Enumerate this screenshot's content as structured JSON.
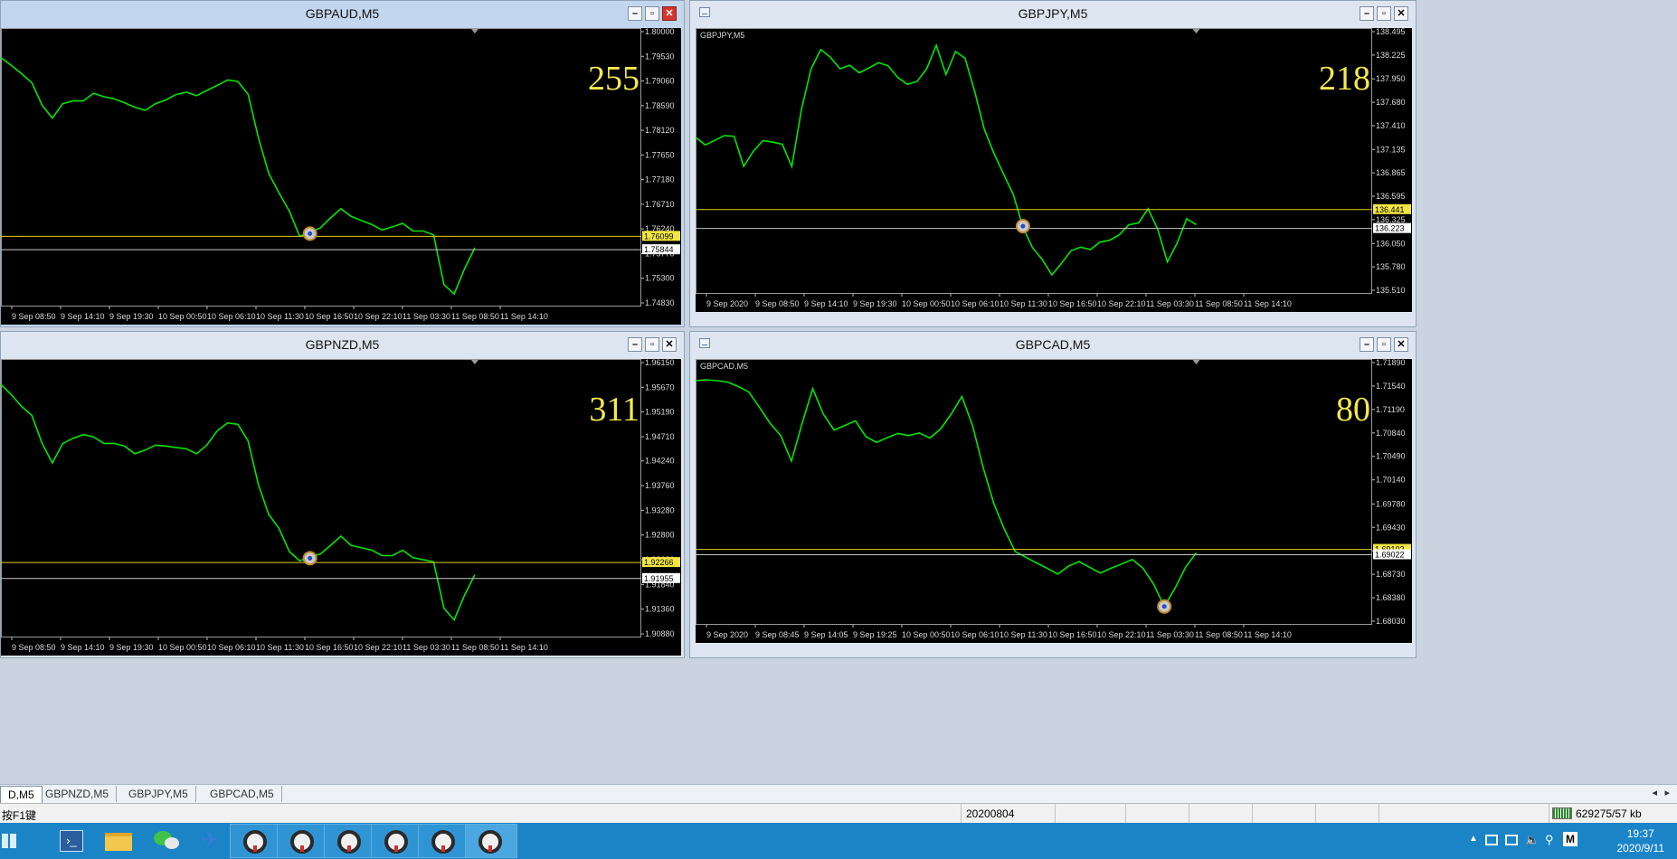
{
  "charts": [
    {
      "title": "GBPAUD,M5",
      "symbol_label": "",
      "countdown": "255",
      "price_axis": [
        "1.80000",
        "1.79530",
        "1.79060",
        "1.78590",
        "1.78120",
        "1.77650",
        "1.77180",
        "1.76710",
        "1.76240",
        "1.75770",
        "1.75300",
        "1.74830"
      ],
      "bid_price": "1.76099",
      "ask_price": "1.75844",
      "time_axis": [
        "9 Sep 08:50",
        "9 Sep 14:10",
        "9 Sep 19:30",
        "10 Sep 00:50",
        "10 Sep 06:10",
        "10 Sep 11:30",
        "10 Sep 16:50",
        "10 Sep 22:10",
        "11 Sep 03:30",
        "11 Sep 08:50",
        "11 Sep 14:10"
      ],
      "series": [
        1.7948,
        1.7938,
        1.792,
        1.79,
        1.7862,
        1.7835,
        1.786,
        1.787,
        1.7868,
        1.788,
        1.7878,
        1.7872,
        1.7862,
        1.7858,
        1.785,
        1.786,
        1.7872,
        1.788,
        1.7882,
        1.788,
        1.7888,
        1.7895,
        1.791,
        1.7905,
        1.7878,
        1.78,
        1.773,
        1.769,
        1.766,
        1.761,
        1.7615,
        1.7628,
        1.7645,
        1.766,
        1.765,
        1.764,
        1.763,
        1.7624,
        1.7628,
        1.7632,
        1.7622,
        1.762,
        1.761,
        1.752,
        1.75,
        1.7545,
        1.759
      ]
    },
    {
      "title": "GBPJPY,M5",
      "symbol_label": "GBPJPY,M5",
      "countdown": "218",
      "price_axis": [
        "138.495",
        "138.225",
        "137.950",
        "137.680",
        "137.410",
        "137.135",
        "136.865",
        "136.595",
        "136.325",
        "136.050",
        "135.780",
        "135.510"
      ],
      "bid_price": "136.441",
      "ask_price": "136.223",
      "time_axis": [
        "9 Sep 2020",
        "9 Sep 08:50",
        "9 Sep 14:10",
        "9 Sep 19:30",
        "10 Sep 00:50",
        "10 Sep 06:10",
        "10 Sep 11:30",
        "10 Sep 16:50",
        "10 Sep 22:10",
        "11 Sep 03:30",
        "11 Sep 08:50",
        "11 Sep 14:10"
      ],
      "series": [
        137.26,
        137.2,
        137.24,
        137.28,
        137.3,
        136.94,
        137.1,
        137.25,
        137.22,
        137.18,
        136.95,
        137.6,
        138.05,
        138.3,
        138.2,
        138.05,
        138.12,
        138.02,
        138.06,
        138.15,
        138.1,
        137.95,
        137.9,
        137.92,
        138.05,
        138.35,
        138.0,
        138.25,
        138.2,
        137.8,
        137.35,
        137.1,
        136.85,
        136.6,
        136.25,
        136.0,
        135.85,
        135.7,
        135.82,
        135.95,
        136.02,
        135.98,
        136.05,
        136.1,
        136.15,
        136.25,
        136.3,
        136.45,
        136.2,
        135.85,
        136.05,
        136.32,
        136.28
      ]
    },
    {
      "title": "GBPNZD,M5",
      "symbol_label": "",
      "countdown": "311",
      "price_axis": [
        "1.96150",
        "1.95670",
        "1.95190",
        "1.94710",
        "1.94240",
        "1.93760",
        "1.93280",
        "1.92800",
        "1.92320",
        "1.91840",
        "1.91360",
        "1.90880"
      ],
      "bid_price": "1.92266",
      "ask_price": "1.91955",
      "time_axis": [
        "9 Sep 08:50",
        "9 Sep 14:10",
        "9 Sep 19:30",
        "10 Sep 00:50",
        "10 Sep 06:10",
        "10 Sep 11:30",
        "10 Sep 16:50",
        "10 Sep 22:10",
        "11 Sep 03:30",
        "11 Sep 08:50",
        "11 Sep 14:10"
      ],
      "series": [
        1.957,
        1.9555,
        1.953,
        1.951,
        1.946,
        1.942,
        1.9455,
        1.947,
        1.9475,
        1.9468,
        1.946,
        1.9458,
        1.945,
        1.944,
        1.9445,
        1.9452,
        1.9455,
        1.945,
        1.9445,
        1.944,
        1.9455,
        1.948,
        1.95,
        1.9495,
        1.946,
        1.938,
        1.932,
        1.929,
        1.925,
        1.923,
        1.9235,
        1.9245,
        1.926,
        1.9275,
        1.9262,
        1.9255,
        1.9248,
        1.9242,
        1.924,
        1.9248,
        1.9238,
        1.9232,
        1.9225,
        1.914,
        1.9115,
        1.916,
        1.9205
      ]
    },
    {
      "title": "GBPCAD,M5",
      "symbol_label": "GBPCAD,M5",
      "countdown": "80",
      "price_axis": [
        "1.71890",
        "1.71540",
        "1.71190",
        "1.70840",
        "1.70490",
        "1.70140",
        "1.69780",
        "1.69430",
        "1.69080",
        "1.68730",
        "1.68380",
        "1.68030"
      ],
      "bid_price": "1.69102",
      "ask_price": "1.69022",
      "time_axis": [
        "9 Sep 2020",
        "9 Sep 08:45",
        "9 Sep 14:05",
        "9 Sep 19:25",
        "10 Sep 00:50",
        "10 Sep 06:10",
        "10 Sep 11:30",
        "10 Sep 16:50",
        "10 Sep 22:10",
        "11 Sep 03:30",
        "11 Sep 08:50",
        "11 Sep 14:10"
      ],
      "series": [
        1.716,
        1.7165,
        1.7162,
        1.7158,
        1.7155,
        1.7145,
        1.712,
        1.71,
        1.708,
        1.704,
        1.71,
        1.715,
        1.711,
        1.709,
        1.7095,
        1.71,
        1.708,
        1.707,
        1.7075,
        1.7085,
        1.708,
        1.7082,
        1.7078,
        1.709,
        1.711,
        1.714,
        1.7095,
        1.703,
        1.698,
        1.694,
        1.6905,
        1.69,
        1.689,
        1.688,
        1.6875,
        1.6885,
        1.689,
        1.6885,
        1.6875,
        1.688,
        1.689,
        1.6895,
        1.688,
        1.686,
        1.6825,
        1.685,
        1.6885,
        1.6905
      ]
    }
  ],
  "tabs": [
    "D,M5",
    "GBPNZD,M5",
    "GBPJPY,M5",
    "GBPCAD,M5"
  ],
  "status": {
    "help": "按F1键",
    "date": "20200804",
    "traffic": "629275/57 kb"
  },
  "clock": {
    "time": "19:37",
    "date": "2020/9/11"
  },
  "colors": {
    "candle": "#00e600",
    "bid_line": "#e0d200",
    "ask_line": "#c8c8c8",
    "label_yellow": "#f2e640",
    "countdown": "#f4e94a"
  }
}
